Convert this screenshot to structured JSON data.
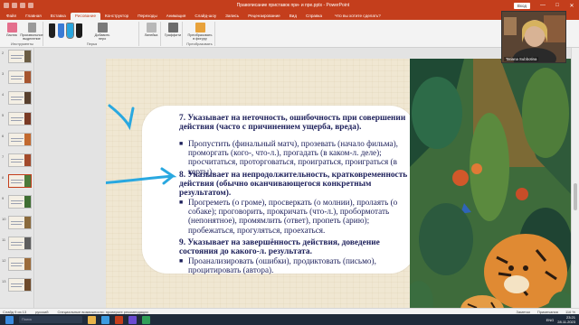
{
  "titlebar": {
    "title": "Правописание приставок при- и пре.pptx  -  PowerPoint",
    "signin": "Вход",
    "minimize": "—",
    "maximize": "□",
    "close": "✕"
  },
  "tabs": [
    "Файл",
    "Главная",
    "Вставка",
    "Рисование",
    "Конструктор",
    "Переходы",
    "Анимация",
    "Слайд-шоу",
    "Запись",
    "Рецензирование",
    "Вид",
    "Справка"
  ],
  "tellme": "Что вы хотите сделать?",
  "ribbon": {
    "draw_group_label": "Инструменты",
    "pens_group_label": "Перья",
    "tools_group_label": "Преобразовать",
    "lasso": "Ластик",
    "selection": "Произвольное выделение",
    "add_pen": "Добавить перо",
    "ruler": "Линейка",
    "graffiti": "Граффити",
    "convert": "Преобразовать в фигуру"
  },
  "slide_numbers": [
    "2",
    "3",
    "4",
    "5",
    "6",
    "7",
    "8",
    "9",
    "10",
    "11",
    "12",
    "13"
  ],
  "slide": {
    "h7": "7. Указывает на неточность, ошибочность при совершении действия (часто с причинением ущерба, вреда).",
    "i7": "Пропустить (финальный матч), прозевать (начало фильма), проморгать (кого-, что-л.), прогадать (в каком-л. деле); просчитаться, проторговаться, проиграться, проиграться (в карты).",
    "h8": "8. Указывает на непродолжительность, кратковременность действия (обычно оканчивающегося конкретным результатом).",
    "i8": "Прогреметь (о громе), просверкать (о молнии), пролаять (о собаке); проговорить, прокричать (что-л.), пробормотать (непонятное), промямлить (ответ), пропеть (арию); пробежаться, прогуляться, проехаться.",
    "h9": "9. Указывает на завершённость действия, доведение состояния до какого-л. результата.",
    "i9": "Проанализировать (ошибки), продиктовать (письмо), процитировать (автора)."
  },
  "webcam_name": "Tatiana Subbotina",
  "status": {
    "slide_of": "Слайд 9 из 13",
    "language": "русский",
    "accessibility": "Специальные возможности: проверьте рекомендации",
    "notes": "Заметки",
    "comments": "Примечания",
    "zoom": "116 %"
  },
  "taskbar": {
    "search": "Поиск",
    "lang": "ENG",
    "time": "23:21",
    "date": "28.11.2023"
  },
  "colors": {
    "accent": "#c43e1c",
    "slide_text": "#1c1f5a",
    "annotation": "#29a8e0"
  }
}
